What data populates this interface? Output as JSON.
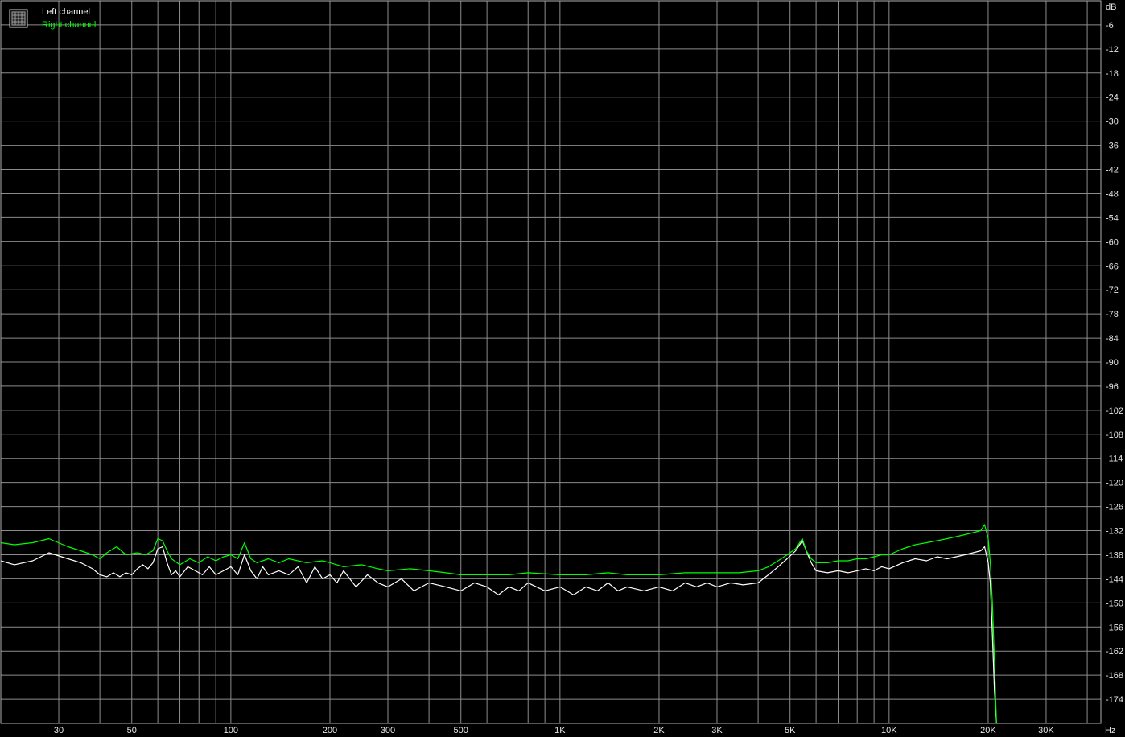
{
  "chart_data": {
    "type": "line",
    "title": "",
    "xlabel": "",
    "ylabel": "",
    "x_unit_label": "Hz",
    "y_unit_label": "dB",
    "x_scale": "log",
    "xlim": [
      20,
      44000
    ],
    "ylim": [
      -180,
      0
    ],
    "grid": true,
    "legend": "top-left",
    "x_ticks": [
      {
        "value": 30,
        "label": "30"
      },
      {
        "value": 50,
        "label": "50"
      },
      {
        "value": 100,
        "label": "100"
      },
      {
        "value": 200,
        "label": "200"
      },
      {
        "value": 300,
        "label": "300"
      },
      {
        "value": 500,
        "label": "500"
      },
      {
        "value": 1000,
        "label": "1K"
      },
      {
        "value": 2000,
        "label": "2K"
      },
      {
        "value": 3000,
        "label": "3K"
      },
      {
        "value": 5000,
        "label": "5K"
      },
      {
        "value": 10000,
        "label": "10K"
      },
      {
        "value": 20000,
        "label": "20K"
      },
      {
        "value": 30000,
        "label": "30K"
      }
    ],
    "y_ticks": [
      {
        "value": -6,
        "label": "-6"
      },
      {
        "value": -12,
        "label": "-12"
      },
      {
        "value": -18,
        "label": "-18"
      },
      {
        "value": -24,
        "label": "-24"
      },
      {
        "value": -30,
        "label": "-30"
      },
      {
        "value": -36,
        "label": "-36"
      },
      {
        "value": -42,
        "label": "-42"
      },
      {
        "value": -48,
        "label": "-48"
      },
      {
        "value": -54,
        "label": "-54"
      },
      {
        "value": -60,
        "label": "-60"
      },
      {
        "value": -66,
        "label": "-66"
      },
      {
        "value": -72,
        "label": "-72"
      },
      {
        "value": -78,
        "label": "-78"
      },
      {
        "value": -84,
        "label": "-84"
      },
      {
        "value": -90,
        "label": "-90"
      },
      {
        "value": -96,
        "label": "-96"
      },
      {
        "value": -102,
        "label": "-102"
      },
      {
        "value": -108,
        "label": "-108"
      },
      {
        "value": -114,
        "label": "-114"
      },
      {
        "value": -120,
        "label": "-120"
      },
      {
        "value": -126,
        "label": "-126"
      },
      {
        "value": -132,
        "label": "-132"
      },
      {
        "value": -138,
        "label": "-138"
      },
      {
        "value": -144,
        "label": "-144"
      },
      {
        "value": -150,
        "label": "-150"
      },
      {
        "value": -156,
        "label": "-156"
      },
      {
        "value": -162,
        "label": "-162"
      },
      {
        "value": -168,
        "label": "-168"
      },
      {
        "value": -174,
        "label": "-174"
      }
    ],
    "series": [
      {
        "name": "Left channel",
        "color": "#ffffff",
        "points": [
          [
            20,
            -139.5
          ],
          [
            22,
            -140.5
          ],
          [
            25,
            -139.5
          ],
          [
            28,
            -137.5
          ],
          [
            32,
            -139
          ],
          [
            35,
            -140
          ],
          [
            38,
            -141.5
          ],
          [
            40,
            -143
          ],
          [
            42,
            -143.5
          ],
          [
            44,
            -142.5
          ],
          [
            46,
            -143.5
          ],
          [
            48,
            -142.5
          ],
          [
            50,
            -143
          ],
          [
            52,
            -141.5
          ],
          [
            54,
            -140.5
          ],
          [
            56,
            -141.5
          ],
          [
            58,
            -140
          ],
          [
            60,
            -136.5
          ],
          [
            62,
            -136
          ],
          [
            64,
            -140
          ],
          [
            66,
            -143
          ],
          [
            68,
            -142
          ],
          [
            70,
            -143.5
          ],
          [
            74,
            -141
          ],
          [
            78,
            -142
          ],
          [
            82,
            -143
          ],
          [
            86,
            -141
          ],
          [
            90,
            -143
          ],
          [
            95,
            -142
          ],
          [
            100,
            -141
          ],
          [
            105,
            -143
          ],
          [
            110,
            -138
          ],
          [
            115,
            -142
          ],
          [
            120,
            -144
          ],
          [
            125,
            -141
          ],
          [
            130,
            -143
          ],
          [
            140,
            -142
          ],
          [
            150,
            -143
          ],
          [
            160,
            -141
          ],
          [
            170,
            -145
          ],
          [
            180,
            -141
          ],
          [
            190,
            -144
          ],
          [
            200,
            -143
          ],
          [
            210,
            -145
          ],
          [
            220,
            -142
          ],
          [
            240,
            -146
          ],
          [
            260,
            -143
          ],
          [
            280,
            -145
          ],
          [
            300,
            -146
          ],
          [
            330,
            -144
          ],
          [
            360,
            -147
          ],
          [
            400,
            -145
          ],
          [
            450,
            -146
          ],
          [
            500,
            -147
          ],
          [
            550,
            -145
          ],
          [
            600,
            -146
          ],
          [
            650,
            -148
          ],
          [
            700,
            -146
          ],
          [
            750,
            -147
          ],
          [
            800,
            -145
          ],
          [
            900,
            -147
          ],
          [
            1000,
            -146
          ],
          [
            1100,
            -148
          ],
          [
            1200,
            -146
          ],
          [
            1300,
            -147
          ],
          [
            1400,
            -145
          ],
          [
            1500,
            -147
          ],
          [
            1600,
            -146
          ],
          [
            1800,
            -147
          ],
          [
            2000,
            -146
          ],
          [
            2200,
            -147
          ],
          [
            2400,
            -145
          ],
          [
            2600,
            -146
          ],
          [
            2800,
            -145
          ],
          [
            3000,
            -146
          ],
          [
            3300,
            -145
          ],
          [
            3600,
            -145.5
          ],
          [
            4000,
            -145
          ],
          [
            4300,
            -143
          ],
          [
            4600,
            -141
          ],
          [
            4900,
            -139
          ],
          [
            5200,
            -137
          ],
          [
            5450,
            -134.5
          ],
          [
            5600,
            -137
          ],
          [
            5800,
            -140
          ],
          [
            6000,
            -142
          ],
          [
            6500,
            -142.5
          ],
          [
            7000,
            -142
          ],
          [
            7500,
            -142.5
          ],
          [
            8000,
            -142
          ],
          [
            8500,
            -141.5
          ],
          [
            9000,
            -142
          ],
          [
            9500,
            -141
          ],
          [
            10000,
            -141.5
          ],
          [
            11000,
            -140
          ],
          [
            12000,
            -139
          ],
          [
            13000,
            -139.5
          ],
          [
            14000,
            -138.5
          ],
          [
            15000,
            -139
          ],
          [
            16000,
            -138.5
          ],
          [
            17000,
            -138
          ],
          [
            18000,
            -137.5
          ],
          [
            19000,
            -137
          ],
          [
            19500,
            -136
          ],
          [
            20000,
            -140
          ],
          [
            20300,
            -145
          ],
          [
            20600,
            -158
          ],
          [
            20900,
            -172
          ],
          [
            21200,
            -180
          ]
        ]
      },
      {
        "name": "Right channel",
        "color": "#00ff00",
        "points": [
          [
            20,
            -135
          ],
          [
            22,
            -135.5
          ],
          [
            25,
            -135
          ],
          [
            28,
            -134
          ],
          [
            32,
            -136
          ],
          [
            35,
            -137
          ],
          [
            38,
            -138
          ],
          [
            40,
            -139
          ],
          [
            42,
            -137.5
          ],
          [
            45,
            -136
          ],
          [
            48,
            -138
          ],
          [
            52,
            -137.5
          ],
          [
            55,
            -138
          ],
          [
            58,
            -137
          ],
          [
            60,
            -134
          ],
          [
            62,
            -134.5
          ],
          [
            64,
            -137
          ],
          [
            66,
            -139
          ],
          [
            70,
            -140.5
          ],
          [
            75,
            -139
          ],
          [
            80,
            -140
          ],
          [
            85,
            -138.5
          ],
          [
            90,
            -139.5
          ],
          [
            95,
            -138.5
          ],
          [
            100,
            -138
          ],
          [
            105,
            -139
          ],
          [
            110,
            -135
          ],
          [
            115,
            -139
          ],
          [
            120,
            -140
          ],
          [
            130,
            -139
          ],
          [
            140,
            -140
          ],
          [
            150,
            -139
          ],
          [
            170,
            -140
          ],
          [
            190,
            -139.5
          ],
          [
            200,
            -140
          ],
          [
            220,
            -141
          ],
          [
            250,
            -140.5
          ],
          [
            280,
            -141.5
          ],
          [
            300,
            -142
          ],
          [
            350,
            -141.5
          ],
          [
            400,
            -142
          ],
          [
            450,
            -142.5
          ],
          [
            500,
            -143
          ],
          [
            600,
            -143
          ],
          [
            700,
            -143
          ],
          [
            800,
            -142.5
          ],
          [
            1000,
            -143
          ],
          [
            1200,
            -143
          ],
          [
            1400,
            -142.5
          ],
          [
            1600,
            -143
          ],
          [
            2000,
            -143
          ],
          [
            2400,
            -142.5
          ],
          [
            2800,
            -142.5
          ],
          [
            3000,
            -142.5
          ],
          [
            3500,
            -142.5
          ],
          [
            4000,
            -142
          ],
          [
            4300,
            -141
          ],
          [
            4600,
            -139.5
          ],
          [
            4900,
            -138
          ],
          [
            5200,
            -136.5
          ],
          [
            5450,
            -134
          ],
          [
            5600,
            -137
          ],
          [
            5800,
            -139
          ],
          [
            6000,
            -140
          ],
          [
            6500,
            -140
          ],
          [
            7000,
            -139.5
          ],
          [
            7500,
            -139.5
          ],
          [
            8000,
            -139
          ],
          [
            8500,
            -139
          ],
          [
            9000,
            -138.5
          ],
          [
            9500,
            -138
          ],
          [
            10000,
            -138
          ],
          [
            11000,
            -136.5
          ],
          [
            12000,
            -135.5
          ],
          [
            13000,
            -135
          ],
          [
            14000,
            -134.5
          ],
          [
            15000,
            -134
          ],
          [
            16000,
            -133.5
          ],
          [
            17000,
            -133
          ],
          [
            18000,
            -132.5
          ],
          [
            19000,
            -132
          ],
          [
            19500,
            -130.5
          ],
          [
            20000,
            -134
          ],
          [
            20300,
            -140
          ],
          [
            20600,
            -150
          ],
          [
            20900,
            -165
          ],
          [
            21200,
            -180
          ]
        ]
      }
    ]
  },
  "legend": {
    "left_label": "Left channel",
    "right_label": "Right channel",
    "icon": "grid-icon"
  }
}
